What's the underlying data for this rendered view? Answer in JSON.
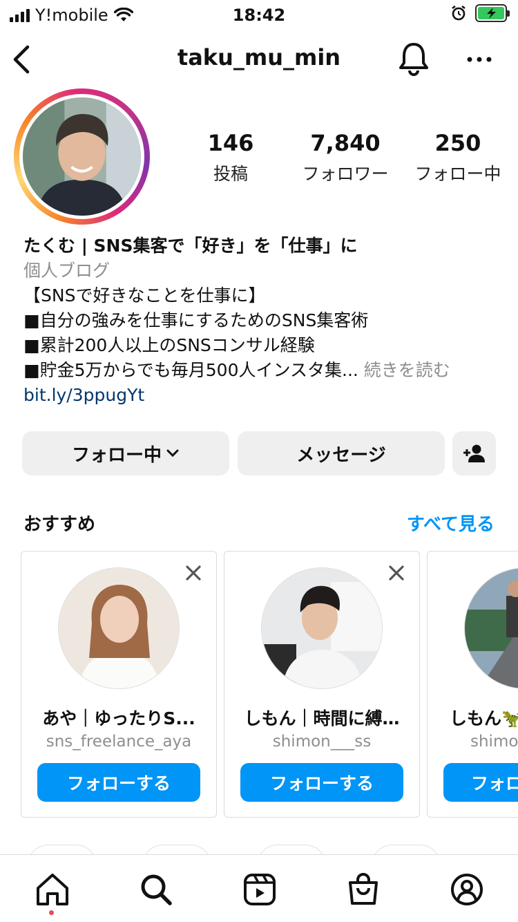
{
  "status_bar": {
    "carrier": "Y!mobile",
    "time": "18:42"
  },
  "nav": {
    "username": "taku_mu_min",
    "back_icon": "chevron-left-icon",
    "bell_icon": "bell-icon",
    "more_icon": "more-horizontal-icon"
  },
  "stats": {
    "posts": {
      "count": "146",
      "label": "投稿"
    },
    "followers": {
      "count": "7,840",
      "label": "フォロワー"
    },
    "following": {
      "count": "250",
      "label": "フォロー中"
    }
  },
  "bio": {
    "name": "たくむ | SNS集客で「好き」を「仕事」に",
    "category": "個人ブログ",
    "lines": [
      "【SNSで好きなことを仕事に】",
      "■自分の強みを仕事にするためのSNS集客術",
      "■累計200人以上のSNSコンサル経験",
      "■貯金5万からでも毎月500人インスタ集..."
    ],
    "more": "続きを読む",
    "link": "bit.ly/3ppugYt"
  },
  "actions": {
    "following_label": "フォロー中",
    "message_label": "メッセージ",
    "add_user_icon": "add-user-icon"
  },
  "suggestions": {
    "title": "おすすめ",
    "see_all": "すべて見る",
    "cards": [
      {
        "name": "あや｜ゆったりS...",
        "username": "sns_freelance_aya",
        "button": "フォローする"
      },
      {
        "name": "しもん｜時間に縛…",
        "username": "shimon___ss",
        "button": "フォローする"
      },
      {
        "name": "しもん🦖",
        "username": "shimon",
        "button": "フォロー"
      }
    ]
  },
  "colors": {
    "accent": "#0095f6",
    "link": "#00376b",
    "muted": "#8e8e8e",
    "button_bg": "#efefef",
    "notification_dot": "#ed4956"
  },
  "tabbar": [
    "home-icon",
    "search-icon",
    "reels-icon",
    "shop-icon",
    "profile-icon"
  ]
}
